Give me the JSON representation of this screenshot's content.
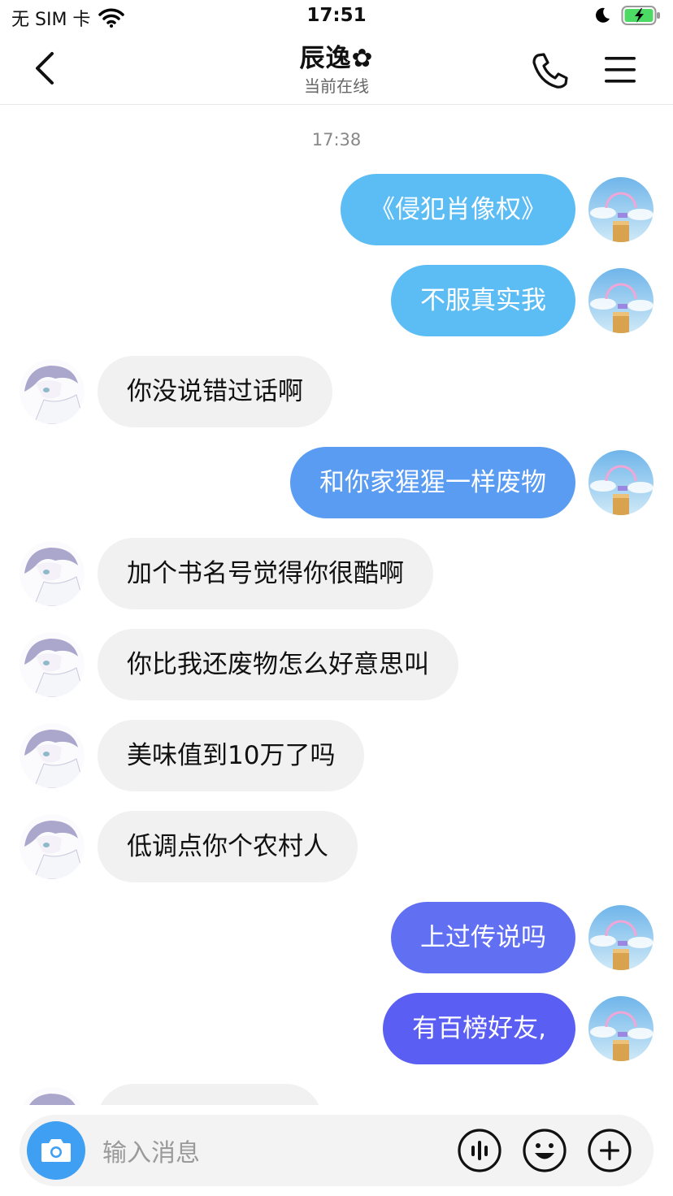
{
  "status": {
    "carrier": "无 SIM 卡",
    "time": "17:51"
  },
  "header": {
    "title": "辰逸✿",
    "subtitle": "当前在线"
  },
  "chat": {
    "timestamp": "17:38",
    "messages": [
      {
        "side": "me",
        "text": "《侵犯肖像权》",
        "color": "#5cbdf5"
      },
      {
        "side": "me",
        "text": "不服真实我",
        "color": "#5cbdf5"
      },
      {
        "side": "them",
        "text": "你没说错过话啊"
      },
      {
        "side": "me",
        "text": "和你家猩猩一样废物",
        "color": "#5a9cf2"
      },
      {
        "side": "them",
        "text": "加个书名号觉得你很酷啊"
      },
      {
        "side": "them",
        "text": "你比我还废物怎么好意思叫"
      },
      {
        "side": "them",
        "text": "美味值到10万了吗"
      },
      {
        "side": "them",
        "text": "低调点你个农村人"
      },
      {
        "side": "me",
        "text": "上过传说吗",
        "color": "#6170f3"
      },
      {
        "side": "me",
        "text": "有百榜好友,",
        "color": "#5a5ef2"
      }
    ]
  },
  "input": {
    "placeholder": "输入消息"
  },
  "icons": {
    "back": "chevron-left-icon",
    "call": "phone-icon",
    "menu": "menu-icon",
    "camera": "camera-icon",
    "voice": "voice-icon",
    "emoji": "emoji-icon",
    "plus": "plus-icon"
  }
}
